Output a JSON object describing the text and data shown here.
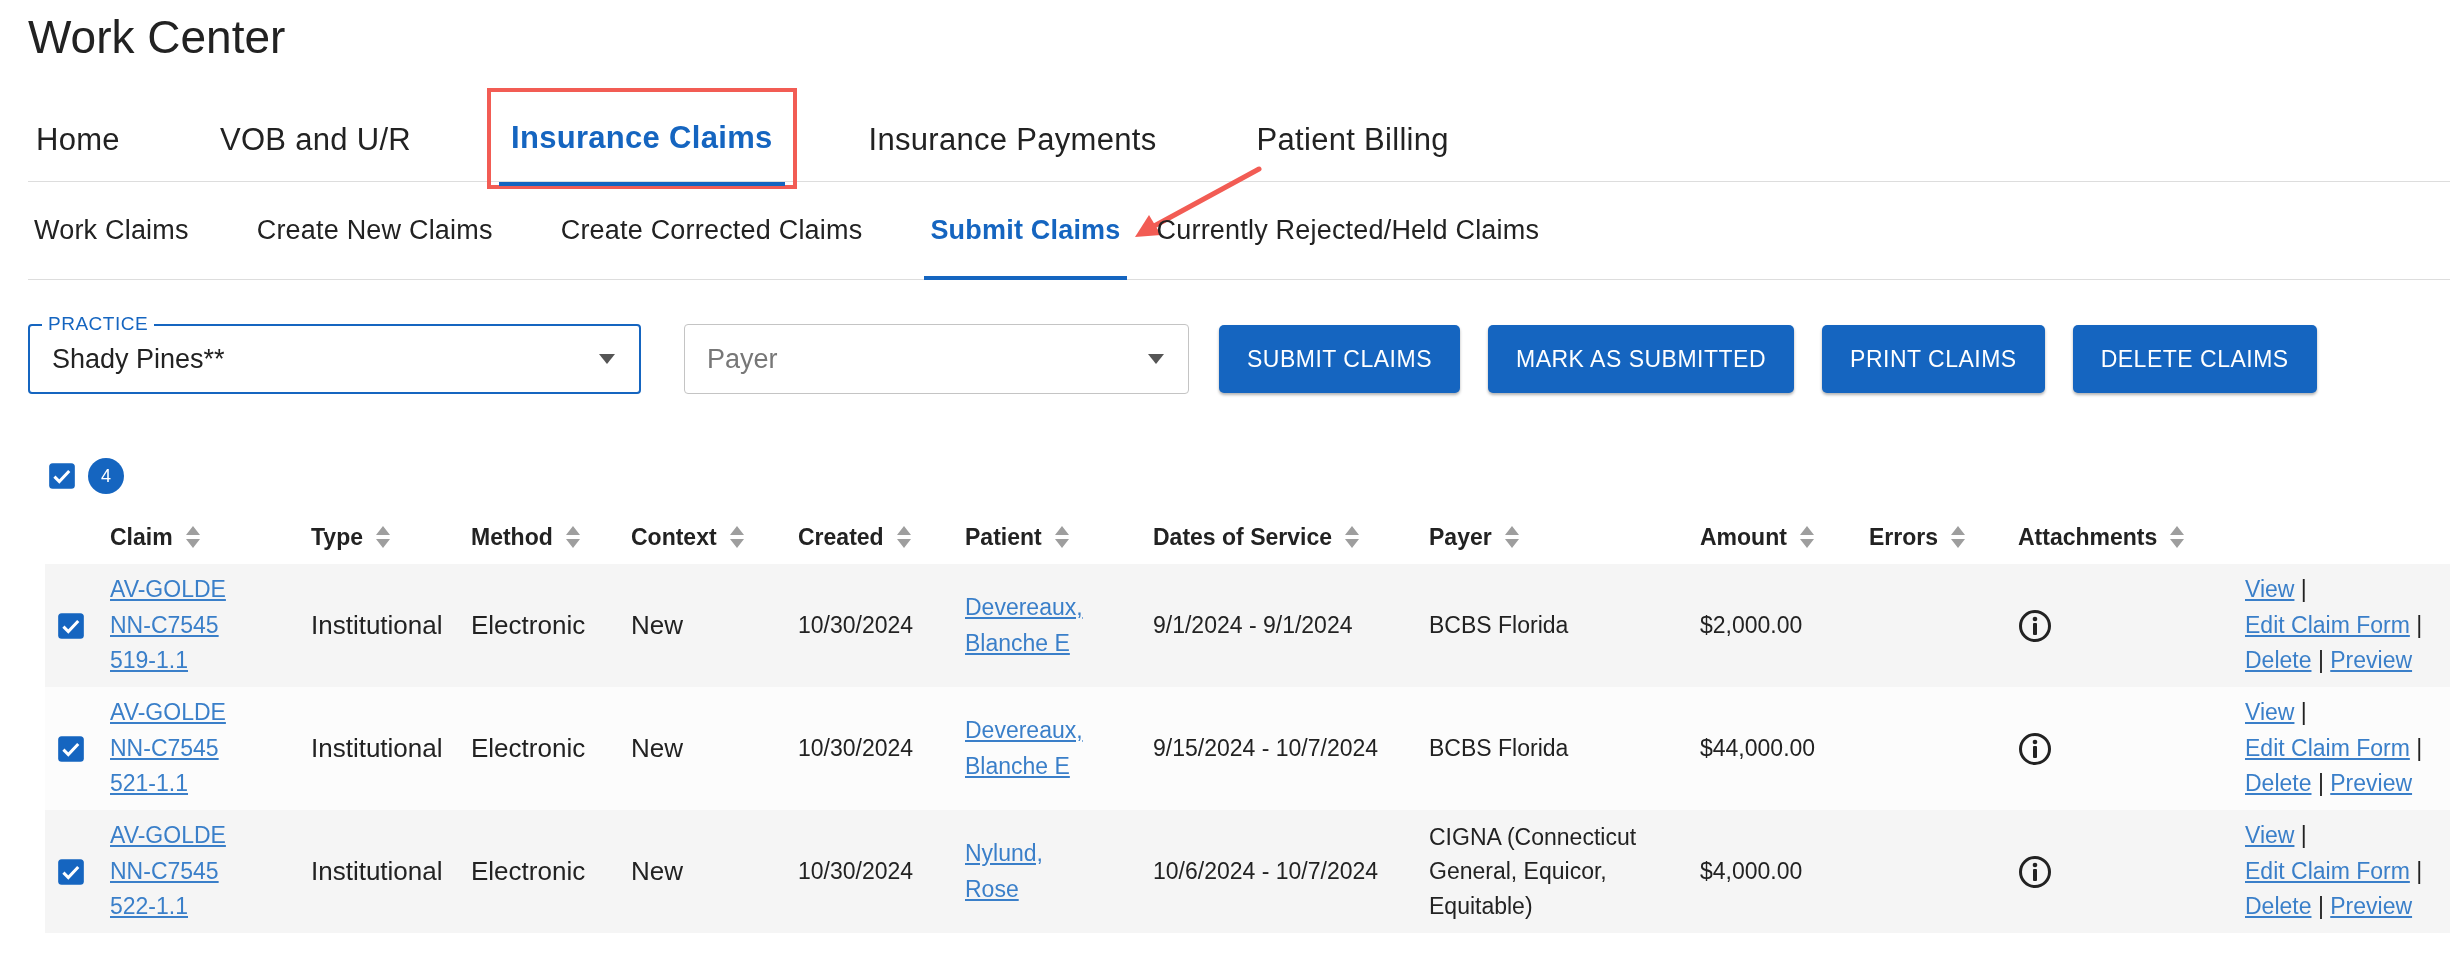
{
  "page_title": "Work Center",
  "main_tabs": [
    {
      "label": "Home",
      "selected": false,
      "highlighted": false
    },
    {
      "label": "VOB and U/R",
      "selected": false,
      "highlighted": false
    },
    {
      "label": "Insurance Claims",
      "selected": true,
      "highlighted": true
    },
    {
      "label": "Insurance Payments",
      "selected": false,
      "highlighted": false
    },
    {
      "label": "Patient Billing",
      "selected": false,
      "highlighted": false
    }
  ],
  "sub_tabs": [
    {
      "label": "Work Claims",
      "selected": false,
      "pointed": false
    },
    {
      "label": "Create New Claims",
      "selected": false,
      "pointed": false
    },
    {
      "label": "Create Corrected Claims",
      "selected": false,
      "pointed": false
    },
    {
      "label": "Submit Claims",
      "selected": true,
      "pointed": true
    },
    {
      "label": "Currently Rejected/Held Claims",
      "selected": false,
      "pointed": false
    }
  ],
  "filters": {
    "practice": {
      "label": "PRACTICE",
      "value": "Shady Pines**"
    },
    "payer": {
      "placeholder": "Payer"
    }
  },
  "buttons": [
    "SUBMIT CLAIMS",
    "MARK AS SUBMITTED",
    "PRINT CLAIMS",
    "DELETE CLAIMS"
  ],
  "selection": {
    "checked": true,
    "count": "4"
  },
  "columns": [
    "Claim",
    "Type",
    "Method",
    "Context",
    "Created",
    "Patient",
    "Dates of Service",
    "Payer",
    "Amount",
    "Errors",
    "Attachments"
  ],
  "rows": [
    {
      "checked": true,
      "claim": "AV-GOLDENN-C7545519-1.1",
      "type": "Institutional",
      "method": "Electronic",
      "context": "New",
      "created": "10/30/2024",
      "patient": "Devereaux, Blanche E",
      "dates": "9/1/2024 - 9/1/2024",
      "payer": "BCBS Florida",
      "amount": "$2,000.00",
      "actions": [
        "View",
        "Edit Claim Form",
        "Delete",
        "Preview"
      ]
    },
    {
      "checked": true,
      "claim": "AV-GOLDENN-C7545521-1.1",
      "type": "Institutional",
      "method": "Electronic",
      "context": "New",
      "created": "10/30/2024",
      "patient": "Devereaux, Blanche E",
      "dates": "9/15/2024 - 10/7/2024",
      "payer": "BCBS Florida",
      "amount": "$44,000.00",
      "actions": [
        "View",
        "Edit Claim Form",
        "Delete",
        "Preview"
      ]
    },
    {
      "checked": true,
      "claim": "AV-GOLDENN-C7545522-1.1",
      "type": "Institutional",
      "method": "Electronic",
      "context": "New",
      "created": "10/30/2024",
      "patient": "Nylund, Rose",
      "dates": "10/6/2024 - 10/7/2024",
      "payer": "CIGNA (Connecticut General, Equicor, Equitable)",
      "amount": "$4,000.00",
      "actions": [
        "View",
        "Edit Claim Form",
        "Delete",
        "Preview"
      ]
    }
  ],
  "action_separator": "|"
}
